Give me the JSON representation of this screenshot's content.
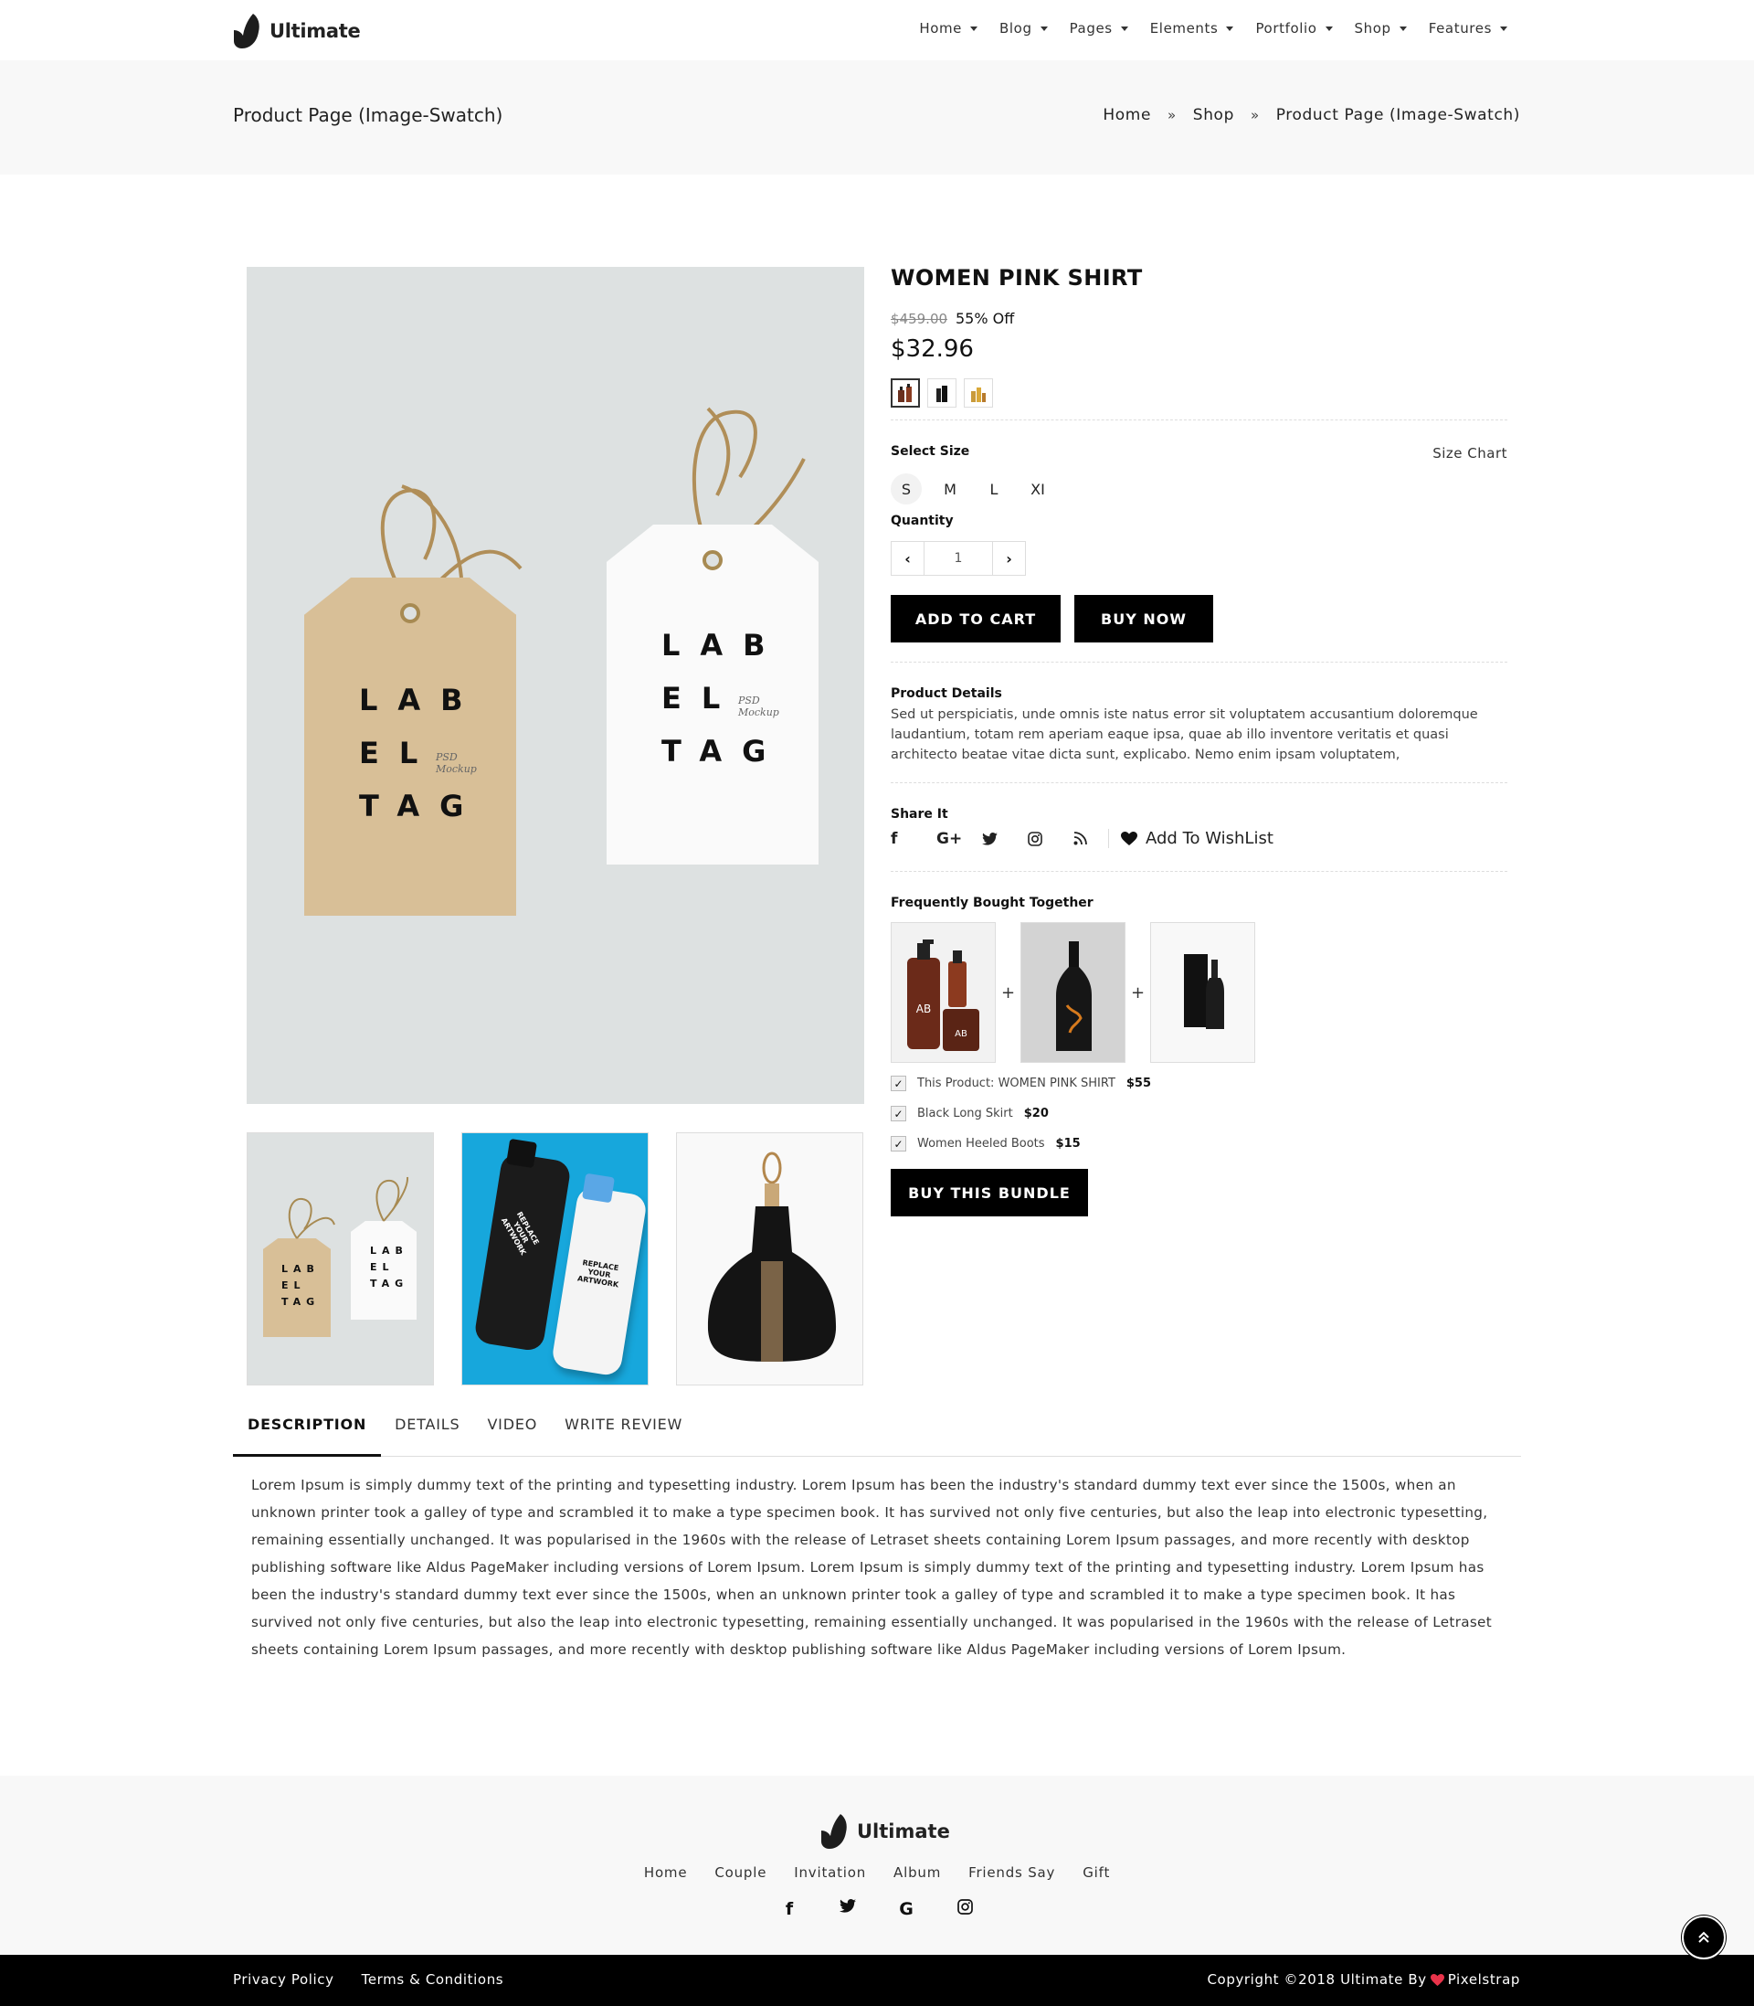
{
  "brand": {
    "name": "Ultimate"
  },
  "nav": {
    "items": [
      "Home",
      "Blog",
      "Pages",
      "Elements",
      "Portfolio",
      "Shop",
      "Features"
    ]
  },
  "page": {
    "title": "Product Page (Image-Swatch)",
    "breadcrumb": [
      "Home",
      "Shop",
      "Product Page (Image-Swatch)"
    ],
    "breadcrumb_sep": "»"
  },
  "gallery": {
    "main_tag_lines": [
      "LAB",
      "EL",
      "TAG"
    ],
    "psd_label": "PSD",
    "mockup_label": "Mockup",
    "bottle_text": [
      "REPLACE",
      "YOUR",
      "ARTWORK"
    ]
  },
  "product": {
    "title": "WOMEN PINK SHIRT",
    "old_price": "$459.00",
    "discount": "55% Off",
    "price": "$32.96",
    "select_size_label": "Select Size",
    "size_chart_label": "Size Chart",
    "sizes": [
      "S",
      "M",
      "L",
      "XI"
    ],
    "quantity_label": "Quantity",
    "quantity_value": "1",
    "add_to_cart": "ADD TO CART",
    "buy_now": "BUY NOW",
    "details_label": "Product Details",
    "details_text": "Sed ut perspiciatis, unde omnis iste natus error sit voluptatem accusantium doloremque laudantium, totam rem aperiam eaque ipsa, quae ab illo inventore veritatis et quasi architecto beatae vitae dicta sunt, explicabo. Nemo enim ipsam voluptatem,",
    "share_label": "Share It",
    "wishlist_label": "Add To WishList"
  },
  "bundle": {
    "label": "Frequently Bought Together",
    "plus": "+",
    "bottle_logo": "AB",
    "items": [
      {
        "name": "This Product: WOMEN PINK SHIRT",
        "price": "$55"
      },
      {
        "name": "Black Long Skirt",
        "price": "$20"
      },
      {
        "name": "Women Heeled Boots",
        "price": "$15"
      }
    ],
    "button": "BUY THIS BUNDLE"
  },
  "tabs": {
    "items": [
      "DESCRIPTION",
      "DETAILS",
      "VIDEO",
      "WRITE REVIEW"
    ],
    "active": "DESCRIPTION",
    "description": "Lorem Ipsum is simply dummy text of the printing and typesetting industry. Lorem Ipsum has been the industry's standard dummy text ever since the 1500s, when an unknown printer took a galley of type and scrambled it to make a type specimen book. It has survived not only five centuries, but also the leap into electronic typesetting, remaining essentially unchanged. It was popularised in the 1960s with the release of Letraset sheets containing Lorem Ipsum passages, and more recently with desktop publishing software like Aldus PageMaker including versions of Lorem Ipsum. Lorem Ipsum is simply dummy text of the printing and typesetting industry. Lorem Ipsum has been the industry's standard dummy text ever since the 1500s, when an unknown printer took a galley of type and scrambled it to make a type specimen book. It has survived not only five centuries, but also the leap into electronic typesetting, remaining essentially unchanged. It was popularised in the 1960s with the release of Letraset sheets containing Lorem Ipsum passages, and more recently with desktop publishing software like Aldus PageMaker including versions of Lorem Ipsum."
  },
  "footer": {
    "links": [
      "Home",
      "Couple",
      "Invitation",
      "Album",
      "Friends Say",
      "Gift"
    ],
    "social": [
      "facebook-icon",
      "twitter-icon",
      "google-icon",
      "instagram-icon"
    ],
    "legal": [
      "Privacy Policy",
      "Terms & Conditions"
    ],
    "copyright": "Copyright ©2018 Ultimate By",
    "credit": "Pixelstrap"
  },
  "colors": {
    "accent": "#000000",
    "heart": "#e8334a",
    "page_bg": "#f8f8f8"
  }
}
